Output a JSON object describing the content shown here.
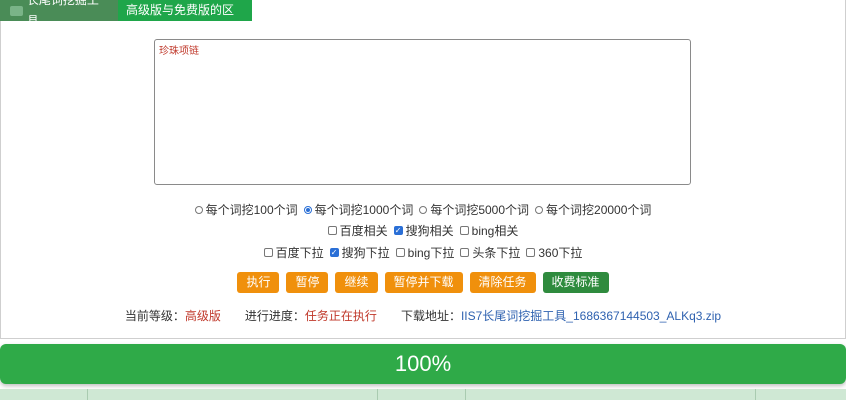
{
  "tabs": [
    {
      "label": "长尾词挖掘工具"
    },
    {
      "label": "高级版与免费版的区别"
    }
  ],
  "keywords": {
    "value": "珍珠项链"
  },
  "word_count_options": [
    {
      "label": "每个词挖100个词",
      "selected": false
    },
    {
      "label": "每个词挖1000个词",
      "selected": true
    },
    {
      "label": "每个词挖5000个词",
      "selected": false
    },
    {
      "label": "每个词挖20000个词",
      "selected": false
    }
  ],
  "related_sources": [
    {
      "label": "百度相关",
      "checked": false
    },
    {
      "label": "搜狗相关",
      "checked": true
    },
    {
      "label": "bing相关",
      "checked": false
    }
  ],
  "dropdown_sources": [
    {
      "label": "百度下拉",
      "checked": false
    },
    {
      "label": "搜狗下拉",
      "checked": true
    },
    {
      "label": "bing下拉",
      "checked": false
    },
    {
      "label": "头条下拉",
      "checked": false
    },
    {
      "label": "360下拉",
      "checked": false
    }
  ],
  "buttons": {
    "run": "执行",
    "pause": "暂停",
    "resume": "继续",
    "pause_download": "暂停并下载",
    "clear": "清除任务",
    "pricing": "收费标准"
  },
  "status": {
    "level_label": "当前等级：",
    "level_value": "高级版",
    "progress_label": "进行进度：",
    "progress_value": "任务正在执行",
    "download_label": "下载地址：",
    "download_value": "IIS7长尾词挖掘工具_1686367144503_ALKq3.zip"
  },
  "progress": {
    "text": "100%",
    "fraction": 1.0
  },
  "colors": {
    "orange": "#f0900c",
    "green": "#2faa48",
    "red": "#c0392b",
    "blue": "#2f62b0"
  }
}
